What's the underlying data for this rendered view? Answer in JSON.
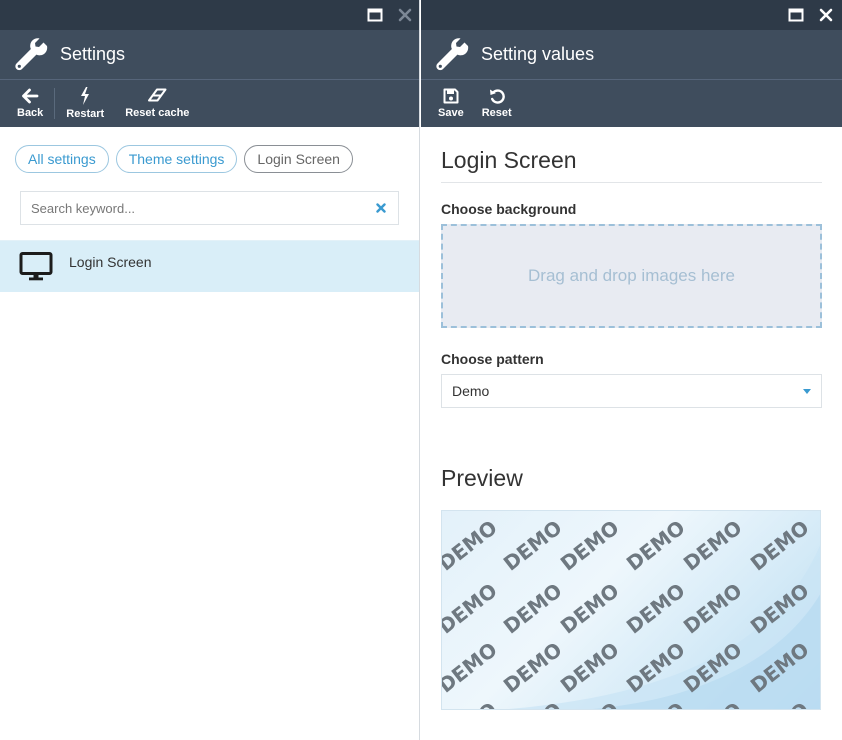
{
  "left": {
    "header_title": "Settings",
    "toolbar": {
      "back": "Back",
      "restart": "Restart",
      "reset_cache": "Reset cache"
    },
    "filters": [
      "All settings",
      "Theme settings",
      "Login Screen"
    ],
    "search": {
      "placeholder": "Search keyword..."
    },
    "items": [
      {
        "label": "Login Screen",
        "icon": "monitor-icon"
      }
    ]
  },
  "right": {
    "header_title": "Setting values",
    "toolbar": {
      "save": "Save",
      "reset": "Reset"
    },
    "section_title": "Login Screen",
    "background_label": "Choose background",
    "dropzone_text": "Drag and drop images here",
    "pattern_label": "Choose pattern",
    "pattern_value": "Demo",
    "preview_title": "Preview",
    "preview_watermark": "DEMO"
  },
  "colors": {
    "titlebar": "#2e3a48",
    "header": "#3f4d5d",
    "accent": "#3a9ad0",
    "selected_row": "#d9eef8"
  }
}
